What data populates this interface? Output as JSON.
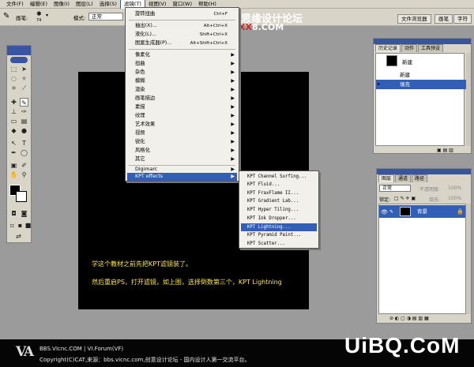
{
  "menubar": {
    "items": [
      "文件(F)",
      "编辑(E)",
      "图像(I)",
      "图层(L)",
      "选择(S)",
      "滤镜(T)",
      "视图(V)",
      "窗口(W)",
      "帮助(H)"
    ],
    "active_index": 5
  },
  "options": {
    "brush_label": "画笔:",
    "brush_size": "74",
    "mode_label": "模式:",
    "mode_value": "正常",
    "tabs": [
      "文件浏览器",
      "画笔",
      "字符"
    ]
  },
  "watermark_top": {
    "site": "思缘设计论坛",
    "url_red": "XX",
    "url_rest": "8.COM"
  },
  "filter_menu": {
    "top": [
      {
        "label": "旋转扭曲",
        "shortcut": "Ctrl+F"
      }
    ],
    "group1": [
      {
        "label": "抽出(X)...",
        "shortcut": "Alt+Ctrl+X"
      },
      {
        "label": "液化(L)...",
        "shortcut": "Shift+Ctrl+X"
      },
      {
        "label": "图案生成器(P)...",
        "shortcut": "Alt+Shift+Ctrl+X"
      }
    ],
    "group2": [
      "像素化",
      "扭曲",
      "杂色",
      "模糊",
      "渲染",
      "画笔描边",
      "素描",
      "纹理",
      "艺术效果",
      "视频",
      "锐化",
      "风格化",
      "其它"
    ],
    "group3": [
      "Digimarc",
      "KPT effects"
    ],
    "highlight": "KPT effects"
  },
  "kpt_menu": {
    "items": [
      "KPT Channel Surfing...",
      "KPT Fluid...",
      "KPT FraxFlame II...",
      "KPT Gradient Lab...",
      "KPT Hyper Tiling...",
      "KPT Ink Dropper...",
      "KPT Lightning...",
      "KPT Pyramid Paint...",
      "KPT Scatter..."
    ],
    "highlight_index": 6
  },
  "history_panel": {
    "tabs": [
      "历史记录",
      "动作",
      "工具预设"
    ],
    "snapshot": "新建",
    "rows": [
      "新建",
      "填充"
    ],
    "highlight_index": 1
  },
  "layers_panel": {
    "tabs": [
      "图层",
      "通道",
      "路径"
    ],
    "blend": "正常",
    "opacity_label": "不透明度:",
    "opacity": "100%",
    "lock_label": "锁定:",
    "fill_label": "填充:",
    "fill": "100%",
    "layer_name": "背景"
  },
  "canvas": {
    "line1": "学这个教材之前先把KPT滤镜装了。",
    "line2": "然后重启PS，打开滤镜，如上图，选择倒数第三个，KPT Lightning"
  },
  "footer": {
    "logo": "VA",
    "line1": "BBS.VIcnc.COM | VI.Forum(VF)",
    "line2": "Copyright(C)CAT,来源：bbs.vicnc.com,创意设计论坛 - 国内设计人第一交流平台。",
    "brand": "UiBQ.CoM"
  }
}
